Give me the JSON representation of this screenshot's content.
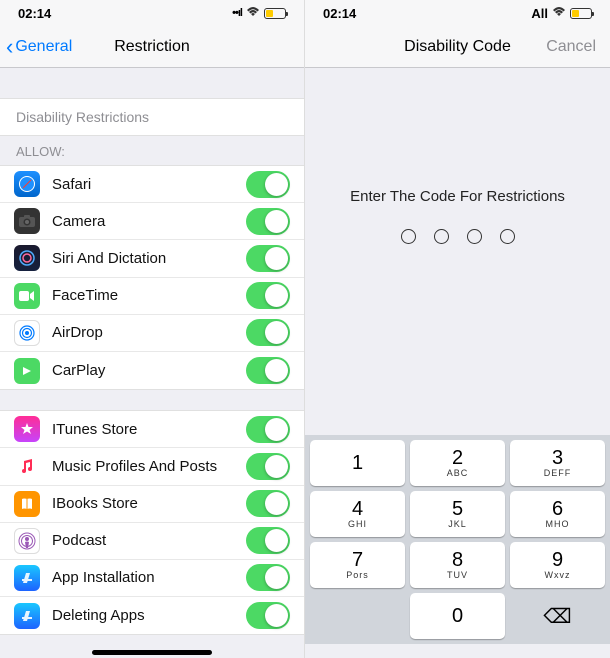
{
  "left": {
    "status": {
      "time": "02:14",
      "signal": "••ıl",
      "all": ""
    },
    "nav": {
      "back": "General",
      "title": "Restriction"
    },
    "disable_link": "Disability Restrictions",
    "allow_header": "ALLOW:",
    "group1": [
      {
        "label": "Safari",
        "icon": "safari"
      },
      {
        "label": "Camera",
        "icon": "camera"
      },
      {
        "label": "Siri And Dictation",
        "icon": "siri"
      },
      {
        "label": "FaceTime",
        "icon": "facetime"
      },
      {
        "label": "AirDrop",
        "icon": "airdrop"
      },
      {
        "label": "CarPlay",
        "icon": "carplay"
      }
    ],
    "group2": [
      {
        "label": "ITunes Store",
        "icon": "itunes"
      },
      {
        "label": "Music Profiles And Posts",
        "icon": "music"
      },
      {
        "label": "IBooks Store",
        "icon": "ibooks"
      },
      {
        "label": "Podcast",
        "icon": "podcast"
      },
      {
        "label": "App Installation",
        "icon": "appstore"
      },
      {
        "label": "Deleting Apps",
        "icon": "delete"
      }
    ]
  },
  "right": {
    "status": {
      "time": "02:14",
      "all": "All"
    },
    "nav": {
      "title": "Disability Code",
      "cancel": "Cancel"
    },
    "prompt": "Enter The Code For Restrictions",
    "keypad": [
      [
        {
          "n": "1",
          "l": ""
        },
        {
          "n": "2",
          "l": "ABC"
        },
        {
          "n": "3",
          "l": "DEFF"
        }
      ],
      [
        {
          "n": "4",
          "l": "GHI"
        },
        {
          "n": "5",
          "l": "JKL"
        },
        {
          "n": "6",
          "l": "MHO"
        }
      ],
      [
        {
          "n": "7",
          "l": "Pors"
        },
        {
          "n": "8",
          "l": "TUV"
        },
        {
          "n": "9",
          "l": "Wxvz"
        }
      ]
    ],
    "zero": "0"
  }
}
